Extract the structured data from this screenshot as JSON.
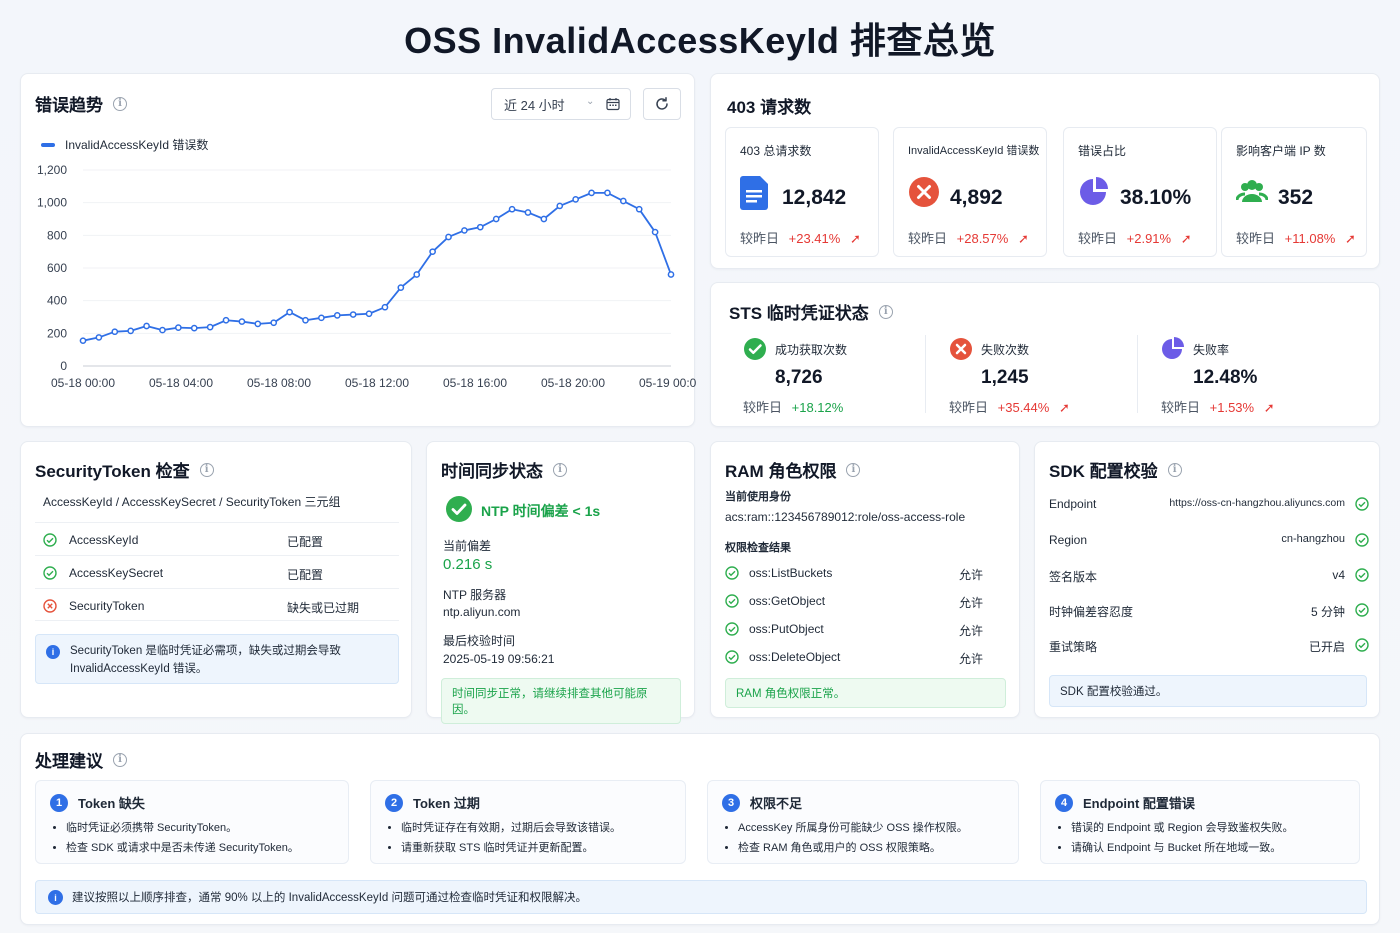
{
  "page_title": "OSS InvalidAccessKeyId 排查总览",
  "trend": {
    "title": "错误趋势",
    "range_select": "近 24 小时",
    "legend": "InvalidAccessKeyId 错误数",
    "chart_data": {
      "type": "line",
      "series": [
        {
          "name": "InvalidAccessKeyId 错误数",
          "values": [
            155,
            175,
            210,
            215,
            245,
            220,
            235,
            232,
            238,
            280,
            272,
            258,
            265,
            330,
            280,
            295,
            310,
            315,
            320,
            360,
            480,
            560,
            700,
            790,
            830,
            850,
            900,
            960,
            940,
            900,
            980,
            1020,
            1060,
            1060,
            1010,
            960,
            820,
            560
          ]
        }
      ],
      "x_ticks": [
        "05-18 00:00",
        "05-18 04:00",
        "05-18 08:00",
        "05-18 12:00",
        "05-18 16:00",
        "05-18 20:00",
        "05-19 00:00"
      ],
      "y_ticks": [
        "0",
        "200",
        "400",
        "600",
        "800",
        "1,000",
        "1,200"
      ],
      "ylim": [
        0,
        1200
      ]
    }
  },
  "requests": {
    "title": "403 请求数",
    "stats": [
      {
        "label": "403 总请求数",
        "value": "12,842",
        "cmp_label": "较昨日",
        "cmp_value": "+23.41%",
        "icon": "document-icon"
      },
      {
        "label": "InvalidAccessKeyId 错误数",
        "value": "4,892",
        "cmp_label": "较昨日",
        "cmp_value": "+28.57%",
        "icon": "error-icon"
      },
      {
        "label": "错误占比",
        "value": "38.10%",
        "cmp_label": "较昨日",
        "cmp_value": "+2.91%",
        "icon": "pie-icon"
      },
      {
        "label": "影响客户端 IP 数",
        "value": "352",
        "cmp_label": "较昨日",
        "cmp_value": "+11.08%",
        "icon": "users-icon"
      }
    ]
  },
  "sts": {
    "title": "STS 临时凭证状态",
    "items": [
      {
        "label": "成功获取次数",
        "value": "8,726",
        "cmp_label": "较昨日",
        "cmp_value": "+18.12%"
      },
      {
        "label": "失败次数",
        "value": "1,245",
        "cmp_label": "较昨日",
        "cmp_value": "+35.44%"
      },
      {
        "label": "失败率",
        "value": "12.48%",
        "cmp_label": "较昨日",
        "cmp_value": "+1.53%"
      }
    ]
  },
  "token": {
    "title": "SecurityToken 检查",
    "subtitle": "AccessKeyId / AccessKeySecret / SecurityToken 三元组",
    "rows": [
      {
        "name": "AccessKeyId",
        "status": "已配置"
      },
      {
        "name": "AccessKeySecret",
        "status": "已配置"
      },
      {
        "name": "SecurityToken",
        "status": "缺失或已过期"
      }
    ],
    "note_line1": "SecurityToken 是临时凭证必需项，缺失或过期会导致",
    "note_line2": "InvalidAccessKeyId 错误。"
  },
  "timesync": {
    "title": "时间同步状态",
    "status": "NTP 时间偏差 < 1s",
    "offset_label": "当前偏差",
    "offset_value": "0.216 s",
    "server_label": "NTP 服务器",
    "server_value": "ntp.aliyun.com",
    "last_label": "最后校验时间",
    "last_value": "2025-05-19 09:56:21",
    "note": "时间同步正常，请继续排查其他可能原因。"
  },
  "ram": {
    "title": "RAM 角色权限",
    "identity_label": "当前使用身份",
    "identity_value": "acs:ram::123456789012:role/oss-access-role",
    "result_label": "权限检查结果",
    "perms": [
      {
        "name": "oss:ListBuckets",
        "status": "允许"
      },
      {
        "name": "oss:GetObject",
        "status": "允许"
      },
      {
        "name": "oss:PutObject",
        "status": "允许"
      },
      {
        "name": "oss:DeleteObject",
        "status": "允许"
      }
    ],
    "note": "RAM 角色权限正常。"
  },
  "sdk": {
    "title": "SDK 配置校验",
    "rows": [
      {
        "name": "Endpoint",
        "value": "https://oss-cn-hangzhou.aliyuncs.com"
      },
      {
        "name": "Region",
        "value": "cn-hangzhou"
      },
      {
        "name": "签名版本",
        "value": "v4"
      },
      {
        "name": "时钟偏差容忍度",
        "value": "5 分钟"
      },
      {
        "name": "重试策略",
        "value": "已开启"
      }
    ],
    "note": "SDK 配置校验通过。"
  },
  "advice": {
    "title": "处理建议",
    "items": [
      {
        "num": "1",
        "title": "Token 缺失",
        "points": [
          "临时凭证必须携带 SecurityToken。",
          "检查 SDK 或请求中是否未传递 SecurityToken。"
        ]
      },
      {
        "num": "2",
        "title": "Token 过期",
        "points": [
          "临时凭证存在有效期，过期后会导致该错误。",
          "请重新获取 STS 临时凭证并更新配置。"
        ]
      },
      {
        "num": "3",
        "title": "权限不足",
        "points": [
          "AccessKey 所属身份可能缺少 OSS 操作权限。",
          "检查 RAM 角色或用户的 OSS 权限策略。"
        ]
      },
      {
        "num": "4",
        "title": "Endpoint 配置错误",
        "points": [
          "错误的 Endpoint 或 Region 会导致鉴权失败。",
          "请确认 Endpoint 与 Bucket 所在地域一致。"
        ]
      }
    ],
    "footer": "建议按照以上顺序排查，通常 90% 以上的 InvalidAccessKeyId 问题可通过检查临时凭证和权限解决。"
  }
}
